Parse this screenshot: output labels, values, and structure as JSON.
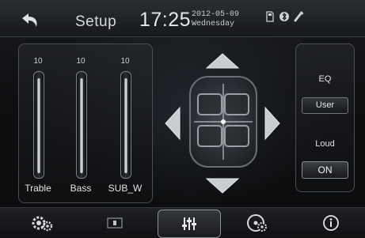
{
  "header": {
    "title": "Setup",
    "time": "17:25",
    "date": "2012-05-09",
    "weekday": "Wednesday",
    "status_icons": [
      "sd-card-icon",
      "bluetooth-icon",
      "usb-icon"
    ]
  },
  "sliders": [
    {
      "label": "Trable",
      "value": "10",
      "level": 1.0
    },
    {
      "label": "Bass",
      "value": "10",
      "level": 1.0
    },
    {
      "label": "SUB_W",
      "value": "10",
      "level": 1.0
    }
  ],
  "eq": {
    "title": "EQ",
    "value": "User"
  },
  "loud": {
    "title": "Loud",
    "value": "ON"
  },
  "balance": {
    "arrows": [
      "up-arrow-icon",
      "down-arrow-icon",
      "left-arrow-icon",
      "right-arrow-icon"
    ]
  },
  "bottom_nav": [
    "general-settings-icon",
    "display-icon",
    "audio-equalizer-icon",
    "disc-settings-icon",
    "info-icon"
  ],
  "colors": {
    "background": "#0c0d0f",
    "text": "#d8dadc"
  }
}
